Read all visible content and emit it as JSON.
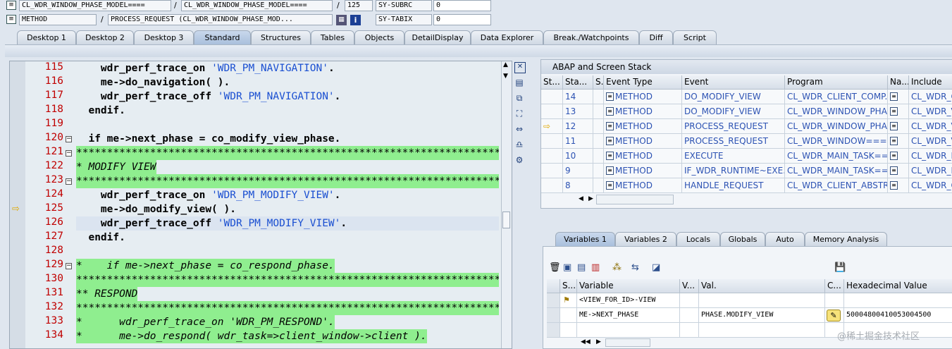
{
  "top": {
    "row1": {
      "class_name": "CL_WDR_WINDOW_PHASE_MODEL====",
      "program": "CL_WDR_WINDOW_PHASE_MODEL====",
      "line": "125",
      "field_name": "SY-SUBRC",
      "field_value": "0"
    },
    "row2": {
      "event_type": "METHOD",
      "event": "PROCESS_REQUEST (CL_WDR_WINDOW_PHASE_MOD...",
      "field_name": "SY-TABIX",
      "field_value": "0"
    },
    "separators": {
      "slash": "/"
    }
  },
  "tabs": [
    "Desktop 1",
    "Desktop 2",
    "Desktop 3",
    "Standard",
    "Structures",
    "Tables",
    "Objects",
    "DetailDisplay",
    "Data Explorer",
    "Break./Watchpoints",
    "Diff",
    "Script"
  ],
  "editor": {
    "lines": [
      {
        "n": "115",
        "text": "    wdr_perf_trace_on 'WDR_PM_NAVIGATION'."
      },
      {
        "n": "116",
        "text": "    me->do_navigation( )."
      },
      {
        "n": "117",
        "text": "    wdr_perf_trace_off 'WDR_PM_NAVIGATION'."
      },
      {
        "n": "118",
        "text": "  endif."
      },
      {
        "n": "119",
        "text": ""
      },
      {
        "n": "120",
        "text": "  if me->next_phase = co_modify_view_phase."
      },
      {
        "n": "121",
        "text": "**********************************************************************"
      },
      {
        "n": "122",
        "text": "* MODIFY VIEW"
      },
      {
        "n": "123",
        "text": "**********************************************************************"
      },
      {
        "n": "124",
        "text": "    wdr_perf_trace_on 'WDR_PM_MODIFY_VIEW'."
      },
      {
        "n": "125",
        "text": "    me->do_modify_view( )."
      },
      {
        "n": "126",
        "text": "    wdr_perf_trace_off 'WDR_PM_MODIFY_VIEW'."
      },
      {
        "n": "127",
        "text": "  endif."
      },
      {
        "n": "128",
        "text": ""
      },
      {
        "n": "129",
        "text": "*    if me->next_phase = co_respond_phase."
      },
      {
        "n": "130",
        "text": "**********************************************************************"
      },
      {
        "n": "131",
        "text": "** RESPOND"
      },
      {
        "n": "132",
        "text": "**********************************************************************"
      },
      {
        "n": "133",
        "text": "*      wdr_perf_trace_on 'WDR_PM_RESPOND'."
      },
      {
        "n": "134",
        "text": "*      me->do_respond( wdr_task=>client_window->client )."
      }
    ]
  },
  "stack": {
    "title": "ABAP and Screen Stack",
    "headers": [
      "St...",
      "Sta...",
      "S...",
      "Event Type",
      "Event",
      "Program",
      "Na...",
      "Include"
    ],
    "rows": [
      {
        "level": "14",
        "type": "METHOD",
        "event": "DO_MODIFY_VIEW",
        "program": "CL_WDR_CLIENT_COMP...",
        "include": "CL_WDR_C"
      },
      {
        "level": "13",
        "type": "METHOD",
        "event": "DO_MODIFY_VIEW",
        "program": "CL_WDR_WINDOW_PHA...",
        "include": "CL_WDR_V"
      },
      {
        "level": "12",
        "type": "METHOD",
        "event": "PROCESS_REQUEST",
        "program": "CL_WDR_WINDOW_PHA...",
        "include": "CL_WDR_V"
      },
      {
        "level": "11",
        "type": "METHOD",
        "event": "PROCESS_REQUEST",
        "program": "CL_WDR_WINDOW===...",
        "include": "CL_WDR_V"
      },
      {
        "level": "10",
        "type": "METHOD",
        "event": "EXECUTE",
        "program": "CL_WDR_MAIN_TASK==...",
        "include": "CL_WDR_M"
      },
      {
        "level": "9",
        "type": "METHOD",
        "event": "IF_WDR_RUNTIME~EXE...",
        "program": "CL_WDR_MAIN_TASK==...",
        "include": "CL_WDR_M"
      },
      {
        "level": "8",
        "type": "METHOD",
        "event": "HANDLE_REQUEST",
        "program": "CL_WDR_CLIENT_ABSTR...",
        "include": "CL_WDR_C"
      }
    ]
  },
  "vartabs": [
    "Variables 1",
    "Variables 2",
    "Locals",
    "Globals",
    "Auto",
    "Memory Analysis"
  ],
  "vars": {
    "headers": [
      "S...",
      "Variable",
      "V...",
      "Val.",
      "C...",
      "Hexadecimal Value"
    ],
    "rows": [
      {
        "variable": "<VIEW_FOR_ID>-VIEW",
        "value": "",
        "hex": ""
      },
      {
        "variable": "ME->NEXT_PHASE",
        "value": "PHASE.MODIFY_VIEW",
        "hex": "50004800410053004500"
      }
    ]
  },
  "watermark": "@稀土掘金技术社区",
  "colors": {
    "comment_bg": "#8fee8f",
    "line_number": "#c00000",
    "string": "#1a4fd1",
    "current_line": "#dbe4f0"
  }
}
